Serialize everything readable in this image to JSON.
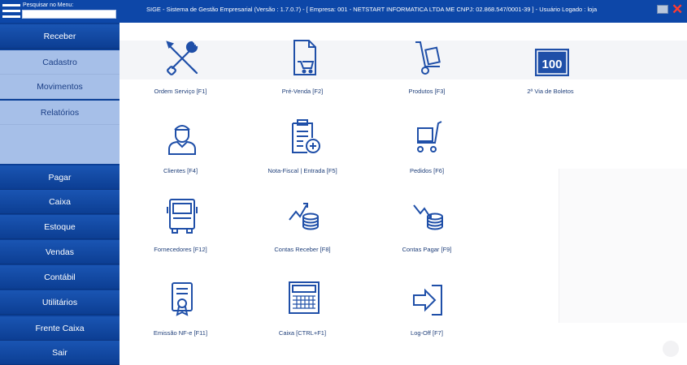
{
  "search": {
    "label": "Pesquisar no Menu:",
    "value": ""
  },
  "title_bar": {
    "text": "SIGE - Sistema de Gestão Empresarial  (Versão : 1.7.0.7) - [ Empresa: 001 - NETSTART INFORMATICA LTDA ME CNPJ: 02.868.547/0001-39 ]  -  Usuário Logado : loja"
  },
  "colors": {
    "topbar": "#0d47a8",
    "sidebar": "#0b3f96",
    "sidebar_light": "#a6bfe8",
    "icon": "#1f4fa8",
    "close": "#ff3b30"
  },
  "sidebar": {
    "items": [
      {
        "label": "Receber"
      },
      {
        "label": "Cadastro"
      },
      {
        "label": "Movimentos"
      },
      {
        "label": "Relatórios"
      },
      {
        "label": "Pagar"
      },
      {
        "label": "Caixa"
      },
      {
        "label": "Estoque"
      },
      {
        "label": "Vendas"
      },
      {
        "label": "Contábil"
      },
      {
        "label": "Utilitários"
      },
      {
        "label": "Frente Caixa"
      },
      {
        "label": "Sair"
      }
    ]
  },
  "tiles": [
    {
      "label": "Ordem Serviço  [F1]",
      "icon": "tools-icon"
    },
    {
      "label": "Pré-Venda  [F2]",
      "icon": "document-cart-icon"
    },
    {
      "label": "Produtos  [F3]",
      "icon": "hand-truck-icon"
    },
    {
      "label": "2ª Via de Boletos",
      "icon": "boleto-100-icon",
      "badge": "100"
    },
    {
      "label": "Clientes  [F4]",
      "icon": "customer-icon"
    },
    {
      "label": "Nota-Fiscal | Entrada  [F5]",
      "icon": "clipboard-add-icon"
    },
    {
      "label": "Pedidos  [F6]",
      "icon": "cart-icon"
    },
    {
      "label": "Fornecedores  [F12]",
      "icon": "truck-icon"
    },
    {
      "label": "Contas Receber  [F8]",
      "icon": "coins-up-icon"
    },
    {
      "label": "Contas Pagar  [F9]",
      "icon": "coins-down-icon"
    },
    {
      "label": "Emissão NF-e  [F11]",
      "icon": "certificate-icon"
    },
    {
      "label": "Caixa  [CTRL+F1]",
      "icon": "calculator-icon"
    },
    {
      "label": "Log-Off  [F7]",
      "icon": "logoff-icon"
    }
  ]
}
